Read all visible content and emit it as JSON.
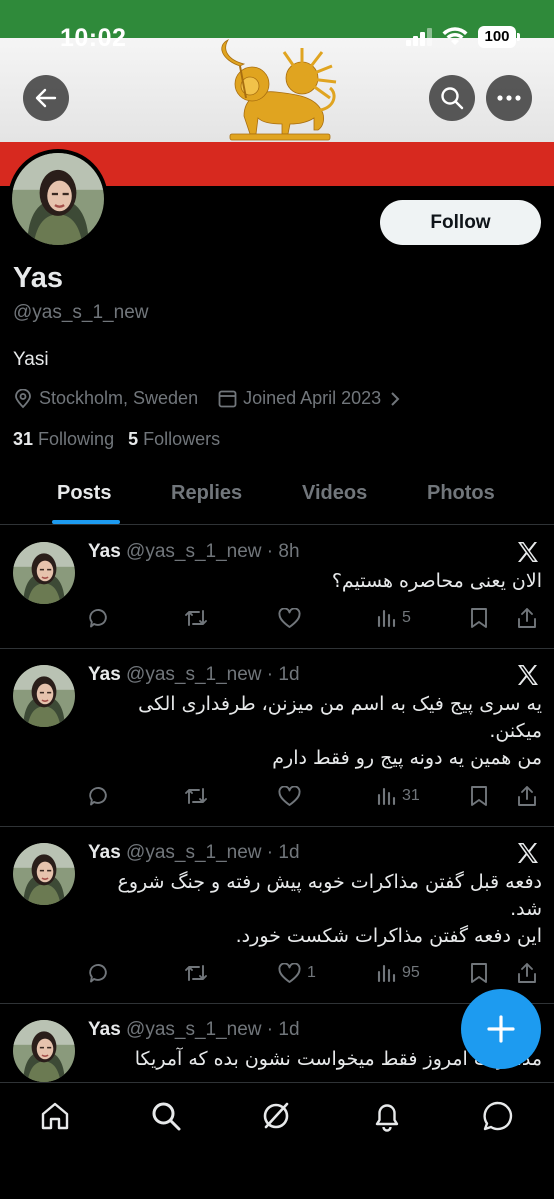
{
  "status_bar": {
    "time": "10:02",
    "battery": "100"
  },
  "profile": {
    "display_name": "Yas",
    "handle": "@yas_s_1_new",
    "bio": "Yasi",
    "location": "Stockholm, Sweden",
    "joined": "Joined April 2023",
    "following_count": "31",
    "following_label": "Following",
    "followers_count": "5",
    "followers_label": "Followers",
    "follow_button": "Follow"
  },
  "tabs": [
    {
      "label": "Posts",
      "active": true
    },
    {
      "label": "Replies",
      "active": false
    },
    {
      "label": "Videos",
      "active": false
    },
    {
      "label": "Photos",
      "active": false
    }
  ],
  "posts": [
    {
      "name": "Yas",
      "handle": "@yas_s_1_new",
      "time": "8h",
      "lines": [
        "الان یعنی محاصره هستیم؟"
      ],
      "likes": "",
      "views": "5"
    },
    {
      "name": "Yas",
      "handle": "@yas_s_1_new",
      "time": "1d",
      "lines": [
        "یه سری پیج فیک به اسم من میزنن، طرفداری الکی",
        "میکنن.",
        "من همین یه دونه پیج رو فقط دارم"
      ],
      "likes": "",
      "views": "31"
    },
    {
      "name": "Yas",
      "handle": "@yas_s_1_new",
      "time": "1d",
      "lines": [
        "دفعه قبل گفتن مذاکرات خوبه پیش رفته و جنگ شروع",
        "شد.",
        "این دفعه گفتن مذاکرات شکست خورد."
      ],
      "likes": "1",
      "views": "95"
    },
    {
      "name": "Yas",
      "handle": "@yas_s_1_new",
      "time": "1d",
      "lines": [
        "مذاکرات امروز فقط میخواست نشون بده که آمریکا"
      ],
      "likes": "",
      "views": ""
    }
  ],
  "colors": {
    "accent": "#1d9bf0",
    "flag_green": "#2f8a3a",
    "flag_red": "#d7291f",
    "emblem_gold": "#e0a420"
  },
  "bottom_nav": [
    "home-icon",
    "search-icon",
    "grok-icon",
    "notifications-icon",
    "messages-icon"
  ]
}
